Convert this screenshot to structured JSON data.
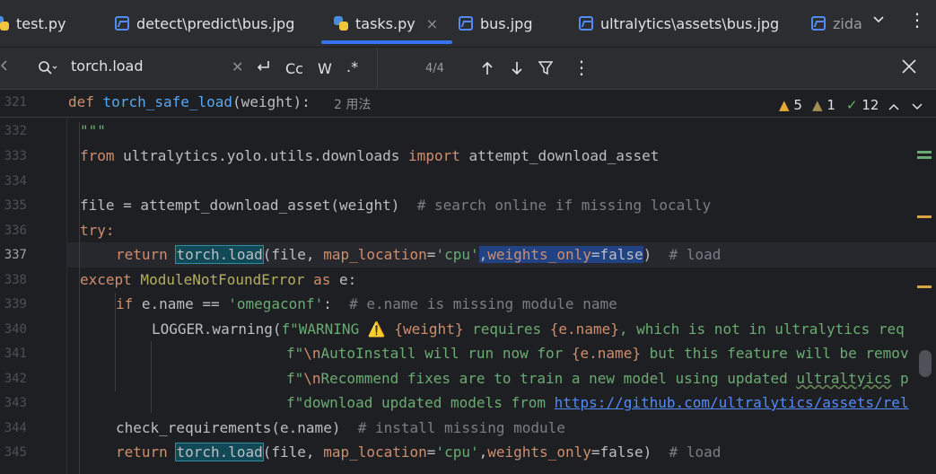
{
  "tabs": [
    {
      "label": "test.py",
      "icon": "python-file-icon",
      "active": false
    },
    {
      "label": "detect\\predict\\bus.jpg",
      "icon": "image-file-icon",
      "active": false
    },
    {
      "label": "tasks.py",
      "icon": "python-file-icon",
      "active": true,
      "close": "×"
    },
    {
      "label": "bus.jpg",
      "icon": "image-file-icon",
      "active": false
    },
    {
      "label": "ultralytics\\assets\\bus.jpg",
      "icon": "image-file-icon",
      "active": false
    },
    {
      "label": "zida",
      "icon": "image-file-icon",
      "active": false
    }
  ],
  "search": {
    "query": "torch.load",
    "match_case": "Cc",
    "words": "W",
    "regex": ".*",
    "counter": "4/4"
  },
  "sticky": {
    "line_no": "321",
    "def_kw": "def",
    "fn_name": "torch_safe_load",
    "params": "(weight):",
    "usages": "2 用法"
  },
  "inspections": {
    "warnings": "5",
    "weak_warnings": "1",
    "ok": "12"
  },
  "lines": [
    {
      "no": "332"
    },
    {
      "no": "333"
    },
    {
      "no": "334"
    },
    {
      "no": "335"
    },
    {
      "no": "336"
    },
    {
      "no": "337"
    },
    {
      "no": "338"
    },
    {
      "no": "339"
    },
    {
      "no": "340"
    },
    {
      "no": "341"
    },
    {
      "no": "342"
    },
    {
      "no": "343"
    },
    {
      "no": "344"
    },
    {
      "no": "345"
    }
  ],
  "code": {
    "l332": "\"\"\"",
    "l333_from": "from",
    "l333_mod": " ultralytics.yolo.utils.downloads ",
    "l333_import": "import",
    "l333_name": " attempt_download_asset",
    "l335_a": "file = attempt_download_asset(weight)  ",
    "l335_cm": "# search online if missing locally",
    "l336": "try:",
    "l337_ret": "return",
    "l337_match": "torch.load",
    "l337_a": "(file, ",
    "l337_prm": "map_location",
    "l337_eq": "=",
    "l337_str": "'cpu'",
    "l337_sel_a": ",",
    "l337_sel_prm": "weights_only",
    "l337_sel_eq": "=false",
    "l337_close": ")  ",
    "l337_cm": "# load",
    "l338_kw": "except",
    "l338_cls": " ModuleNotFoundError ",
    "l338_as": "as",
    "l338_e": " e:",
    "l339_if": "if",
    "l339_a": " e.name == ",
    "l339_str": "'omegaconf'",
    "l339_b": ":  ",
    "l339_cm": "# e.name is missing module name",
    "l340_a": "LOGGER.warning(",
    "l340_s1": "f\"WARNING ⚠️ ",
    "l340_w": "{weight}",
    "l340_s2": " requires ",
    "l340_n": "{e.name}",
    "l340_s3": ", which is not in ultralytics req",
    "l341_s1": "f\"",
    "l341_esc": "\\n",
    "l341_s2": "AutoInstall will run now for ",
    "l341_n": "{e.name}",
    "l341_s3": " but this feature will be remov",
    "l342_s1": "f\"",
    "l342_esc": "\\n",
    "l342_s2": "Recommend fixes are to train a new model using updated ",
    "l342_typo": "ultraltyics",
    "l342_s3": " p",
    "l343_s1": "f\"download updated models from ",
    "l343_link": "https://github.com/ultralytics/assets/rel",
    "l344_a": "check_requirements(e.name)  ",
    "l344_cm": "# install missing module",
    "l345_ret": "return",
    "l345_match": "torch.load",
    "l345_a": "(file, ",
    "l345_prm": "map_location",
    "l345_eq": "=",
    "l345_str": "'cpu'",
    "l345_b": ",",
    "l345_prm2": "weights_only",
    "l345_c": "=false)  ",
    "l345_cm": "# load"
  },
  "colors": {
    "accent": "#3574f0",
    "keyword": "#cf8e6d",
    "function": "#56a8f5",
    "string": "#6aab73",
    "comment": "#7a7e85"
  }
}
